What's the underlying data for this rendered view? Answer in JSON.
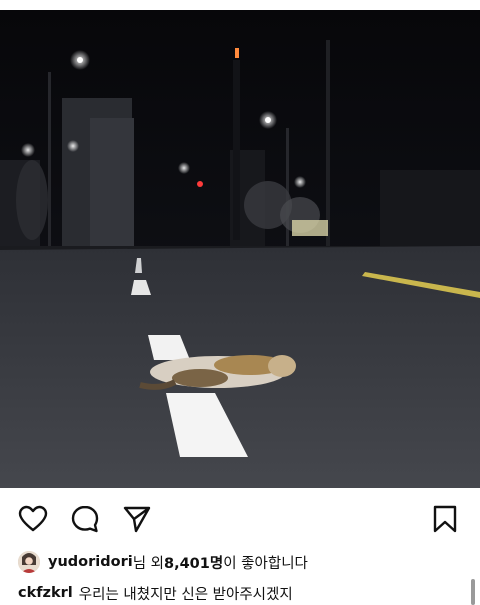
{
  "post": {
    "image_alt": "night road with cat lying on lane marking",
    "liked_by_user": "yudoridori",
    "liked_by_suffix": "님 외 ",
    "like_count": "8,401명",
    "like_suffix": "이 좋아합니다",
    "caption_user": "ckfzkrl",
    "caption_text": "우리는 내쳤지만 신은 받아주시겠지"
  },
  "actions": {
    "like_icon": "heart-icon",
    "comment_icon": "comment-icon",
    "share_icon": "send-icon",
    "save_icon": "bookmark-icon"
  },
  "colors": {
    "text": "#111111",
    "background": "#ffffff",
    "photo_sky": "#0b0b0f",
    "road": "#3a3c42"
  }
}
